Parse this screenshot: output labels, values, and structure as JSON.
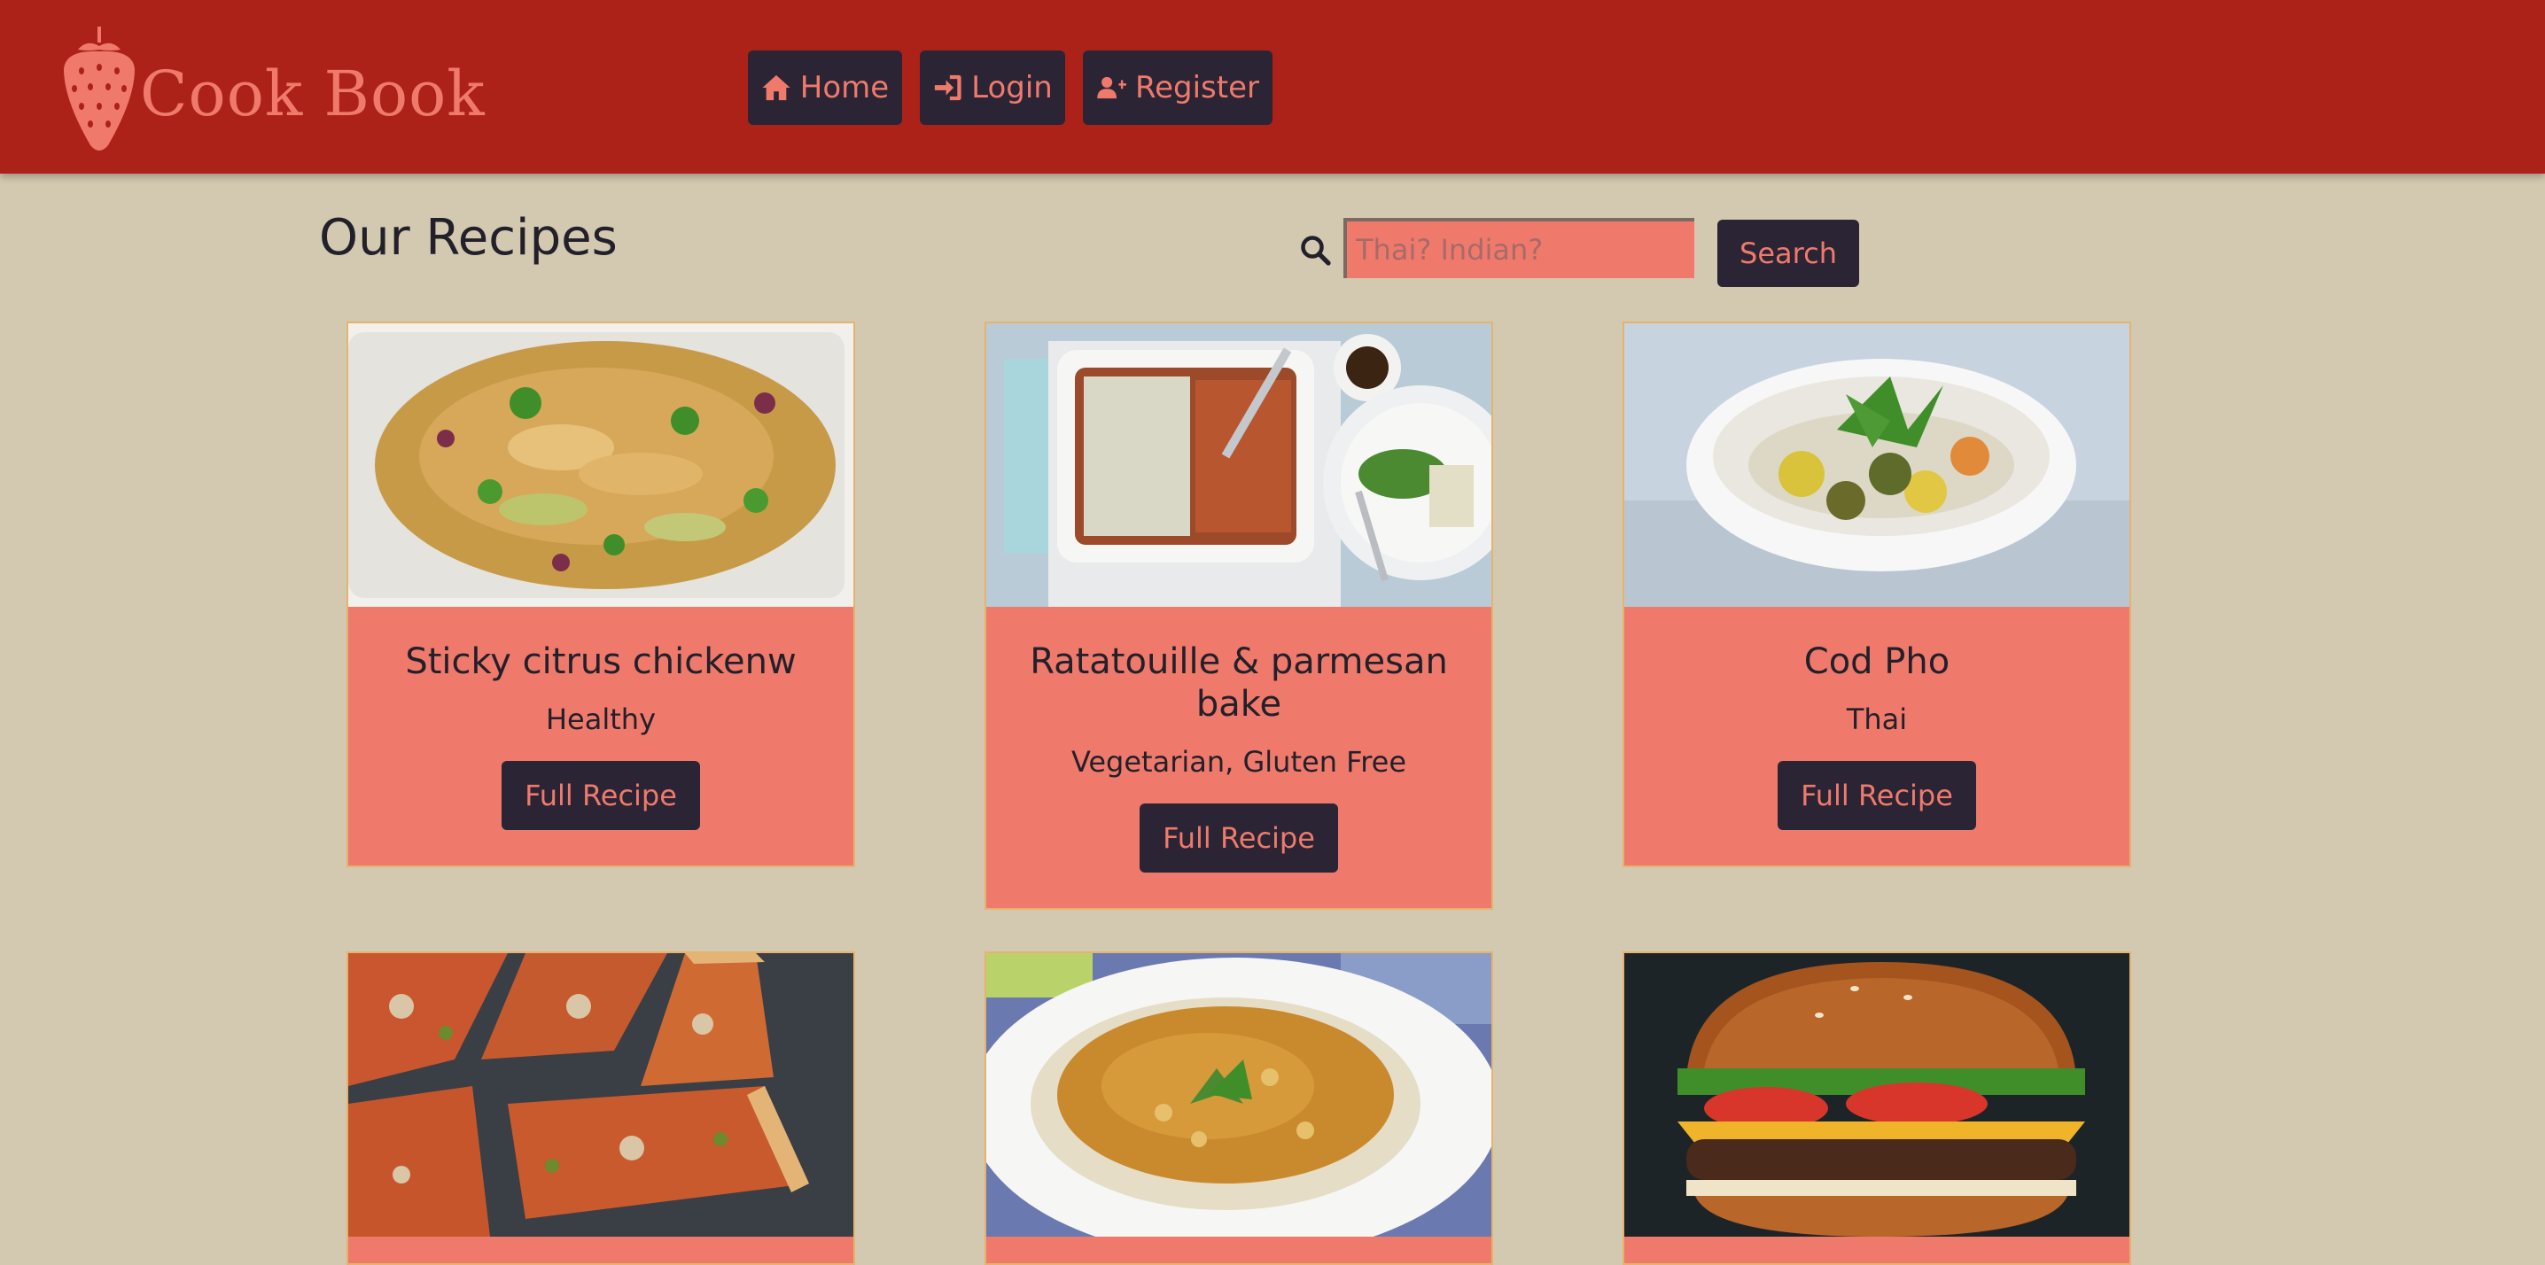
{
  "brand": {
    "name": "Cook Book",
    "logo_icon": "strawberry-icon"
  },
  "nav": [
    {
      "label": "Home",
      "icon": "home-icon"
    },
    {
      "label": "Login",
      "icon": "login-icon"
    },
    {
      "label": "Register",
      "icon": "add-user-icon"
    }
  ],
  "page_title": "Our Recipes",
  "search": {
    "placeholder": "Thai? Indian?",
    "value": "",
    "button_label": "Search"
  },
  "recipes": [
    {
      "title": "Sticky citrus chickenw",
      "tags": "Healthy",
      "button": "Full Recipe"
    },
    {
      "title": "Ratatouille & parmesan bake",
      "tags": "Vegetarian, Gluten Free",
      "button": "Full Recipe"
    },
    {
      "title": "Cod Pho",
      "tags": "Thai",
      "button": "Full Recipe"
    },
    {
      "title": "",
      "tags": "",
      "button": ""
    },
    {
      "title": "",
      "tags": "",
      "button": ""
    },
    {
      "title": "",
      "tags": "",
      "button": ""
    }
  ],
  "colors": {
    "header": "#ad2218",
    "background": "#d3c9b0",
    "accent": "#ef7a6c",
    "dark": "#2b2434"
  }
}
